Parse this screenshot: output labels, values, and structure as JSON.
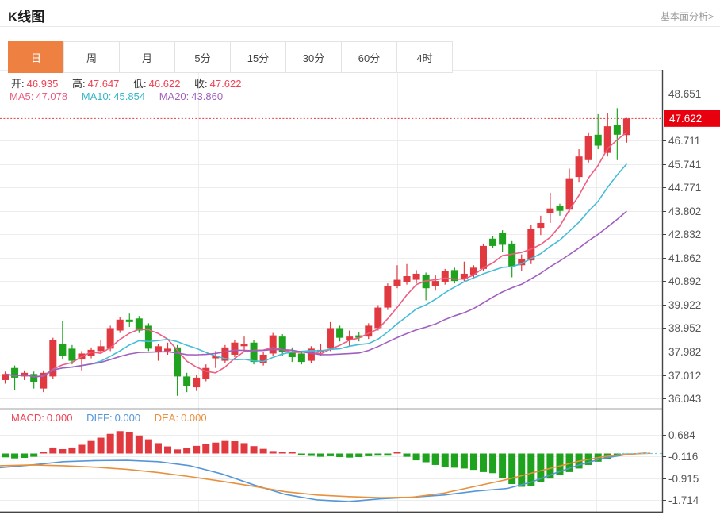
{
  "header": {
    "title": "K线图",
    "analysis_link": "基本面分析>"
  },
  "tabs": {
    "items": [
      "日",
      "周",
      "月",
      "5分",
      "15分",
      "30分",
      "60分",
      "4时"
    ],
    "active_index": 0
  },
  "legend": {
    "open_label": "开:",
    "open": "46.935",
    "high_label": "高:",
    "high": "47.647",
    "low_label": "低:",
    "low": "46.622",
    "close_label": "收:",
    "close": "47.622",
    "ma5_label": "MA5:",
    "ma5": "47.078",
    "ma10_label": "MA10:",
    "ma10": "45.854",
    "ma20_label": "MA20:",
    "ma20": "43.860"
  },
  "macd_legend": {
    "macd_label": "MACD:",
    "macd": "0.000",
    "diff_label": "DIFF:",
    "diff": "0.000",
    "dea_label": "DEA:",
    "dea": "0.000"
  },
  "price_marker": "47.622",
  "colors": {
    "up": "#e0393f",
    "down": "#1fa31f",
    "ma5": "#ee5d82",
    "ma10": "#45bcd8",
    "ma20": "#a05fc0",
    "diff": "#5596d8",
    "dea": "#e8903c",
    "tab_accent": "#ee8142",
    "price_box": "#e8000f",
    "price_line": "#e83b42",
    "grid": "#ededed",
    "axis": "#444444",
    "tick_text": "#555555",
    "zero_dash": "#7ecfdd"
  },
  "chart_data": {
    "type": "candlestick",
    "title": "K线图",
    "main": {
      "y_ticks": [
        "48.651",
        "47.622",
        "46.711",
        "45.741",
        "44.771",
        "43.802",
        "42.832",
        "41.862",
        "40.892",
        "39.922",
        "38.952",
        "37.982",
        "37.012",
        "36.043"
      ],
      "y_range": [
        36.043,
        48.651
      ],
      "current_price": 47.622,
      "ma_periods": [
        5,
        10,
        20
      ],
      "candles": [
        [
          36.8,
          37.05,
          37.15,
          36.65
        ],
        [
          37.3,
          36.9,
          37.4,
          36.4
        ],
        [
          36.95,
          37.1,
          37.2,
          36.8
        ],
        [
          37.05,
          36.7,
          37.15,
          36.45
        ],
        [
          36.45,
          37.1,
          37.2,
          36.3
        ],
        [
          36.95,
          38.45,
          38.55,
          36.85
        ],
        [
          38.3,
          37.8,
          39.25,
          37.65
        ],
        [
          38.1,
          37.6,
          38.25,
          37.45
        ],
        [
          37.65,
          37.9,
          38.0,
          37.2
        ],
        [
          37.8,
          38.05,
          38.15,
          37.7
        ],
        [
          38.0,
          38.2,
          38.45,
          37.9
        ],
        [
          38.1,
          38.95,
          39.05,
          38.0
        ],
        [
          38.85,
          39.3,
          39.4,
          38.75
        ],
        [
          39.3,
          39.2,
          39.55,
          39.0
        ],
        [
          39.35,
          38.85,
          39.45,
          38.75
        ],
        [
          39.05,
          38.1,
          39.15,
          38.0
        ],
        [
          37.95,
          38.2,
          38.3,
          37.6
        ],
        [
          38.0,
          38.1,
          38.35,
          37.85
        ],
        [
          38.15,
          36.95,
          38.25,
          36.15
        ],
        [
          36.95,
          36.55,
          37.1,
          36.3
        ],
        [
          36.5,
          36.9,
          37.0,
          36.35
        ],
        [
          36.85,
          37.3,
          37.45,
          36.75
        ],
        [
          37.7,
          37.8,
          38.0,
          37.3
        ],
        [
          37.6,
          38.15,
          38.25,
          37.5
        ],
        [
          37.85,
          38.35,
          38.45,
          37.75
        ],
        [
          38.2,
          38.3,
          38.6,
          37.95
        ],
        [
          38.35,
          37.55,
          38.45,
          37.45
        ],
        [
          37.5,
          37.85,
          37.95,
          37.4
        ],
        [
          37.9,
          38.65,
          38.75,
          37.8
        ],
        [
          38.6,
          37.95,
          38.7,
          37.8
        ],
        [
          37.95,
          37.75,
          38.15,
          37.55
        ],
        [
          37.9,
          37.55,
          38.0,
          37.45
        ],
        [
          37.6,
          38.1,
          38.2,
          37.5
        ],
        [
          37.95,
          38.05,
          38.3,
          37.8
        ],
        [
          38.1,
          38.95,
          39.2,
          38.0
        ],
        [
          38.95,
          38.55,
          39.05,
          38.4
        ],
        [
          38.45,
          38.6,
          38.85,
          38.2
        ],
        [
          38.65,
          38.55,
          38.8,
          38.4
        ],
        [
          38.6,
          39.05,
          39.15,
          38.5
        ],
        [
          38.95,
          39.8,
          39.9,
          38.85
        ],
        [
          39.8,
          40.7,
          40.8,
          39.7
        ],
        [
          40.7,
          40.95,
          41.55,
          40.6
        ],
        [
          40.85,
          41.1,
          41.6,
          40.75
        ],
        [
          40.95,
          41.2,
          41.35,
          40.8
        ],
        [
          41.15,
          40.6,
          41.25,
          40.1
        ],
        [
          40.7,
          40.9,
          41.15,
          40.5
        ],
        [
          40.85,
          41.3,
          41.4,
          40.75
        ],
        [
          41.35,
          40.9,
          41.45,
          40.8
        ],
        [
          41.0,
          41.2,
          41.7,
          40.9
        ],
        [
          41.15,
          41.45,
          41.55,
          41.05
        ],
        [
          41.4,
          42.35,
          42.45,
          41.3
        ],
        [
          42.65,
          42.35,
          42.75,
          42.25
        ],
        [
          42.9,
          42.4,
          43.0,
          42.1
        ],
        [
          42.45,
          41.5,
          42.55,
          41.05
        ],
        [
          41.55,
          41.8,
          42.0,
          41.3
        ],
        [
          41.75,
          43.05,
          43.2,
          41.6
        ],
        [
          43.1,
          43.3,
          43.6,
          42.8
        ],
        [
          43.7,
          43.9,
          44.55,
          43.3
        ],
        [
          44.0,
          43.8,
          44.1,
          43.6
        ],
        [
          43.85,
          45.15,
          45.55,
          43.75
        ],
        [
          45.2,
          46.05,
          46.35,
          45.0
        ],
        [
          45.9,
          46.9,
          47.05,
          45.8
        ],
        [
          46.95,
          46.5,
          47.8,
          46.35
        ],
        [
          46.2,
          47.3,
          47.85,
          46.05
        ],
        [
          47.35,
          46.95,
          48.05,
          45.9
        ],
        [
          46.935,
          47.622,
          47.647,
          46.622
        ]
      ]
    },
    "macd": {
      "y_ticks": [
        "0.684",
        "-0.116",
        "-0.915",
        "-1.714"
      ],
      "values": {
        "macd": 0.0,
        "diff": 0.0,
        "dea": 0.0
      },
      "histogram": [
        -0.14,
        -0.18,
        -0.16,
        -0.12,
        0.03,
        0.22,
        0.16,
        0.22,
        0.32,
        0.46,
        0.58,
        0.72,
        0.82,
        0.78,
        0.66,
        0.52,
        0.38,
        0.26,
        0.15,
        0.2,
        0.28,
        0.35,
        0.4,
        0.46,
        0.45,
        0.38,
        0.27,
        0.17,
        0.09,
        0.04,
        0.02,
        -0.05,
        -0.09,
        -0.12,
        -0.1,
        -0.13,
        -0.15,
        -0.13,
        -0.1,
        -0.08,
        -0.08,
        0.02,
        -0.12,
        -0.25,
        -0.32,
        -0.42,
        -0.48,
        -0.52,
        -0.55,
        -0.6,
        -0.68,
        -0.72,
        -0.9,
        -1.12,
        -1.22,
        -1.18,
        -1.05,
        -0.92,
        -0.8,
        -0.68,
        -0.55,
        -0.42,
        -0.3,
        -0.2,
        -0.1,
        -0.04
      ],
      "diff_line": [
        [
          0,
          -0.52
        ],
        [
          40,
          -0.42
        ],
        [
          80,
          -0.3
        ],
        [
          120,
          -0.26
        ],
        [
          160,
          -0.25
        ],
        [
          200,
          -0.3
        ],
        [
          240,
          -0.45
        ],
        [
          280,
          -0.75
        ],
        [
          320,
          -1.15
        ],
        [
          360,
          -1.5
        ],
        [
          400,
          -1.7
        ],
        [
          440,
          -1.76
        ],
        [
          480,
          -1.66
        ],
        [
          520,
          -1.6
        ],
        [
          560,
          -1.52
        ],
        [
          600,
          -1.38
        ],
        [
          640,
          -1.28
        ],
        [
          670,
          -1.05
        ],
        [
          700,
          -0.72
        ],
        [
          730,
          -0.42
        ],
        [
          760,
          -0.18
        ],
        [
          790,
          -0.04
        ],
        [
          815,
          0.02
        ]
      ],
      "dea_line": [
        [
          0,
          -0.45
        ],
        [
          40,
          -0.42
        ],
        [
          80,
          -0.45
        ],
        [
          120,
          -0.5
        ],
        [
          160,
          -0.58
        ],
        [
          200,
          -0.7
        ],
        [
          240,
          -0.85
        ],
        [
          280,
          -1.02
        ],
        [
          320,
          -1.2
        ],
        [
          360,
          -1.4
        ],
        [
          400,
          -1.52
        ],
        [
          440,
          -1.58
        ],
        [
          480,
          -1.62
        ],
        [
          520,
          -1.6
        ],
        [
          560,
          -1.45
        ],
        [
          600,
          -1.2
        ],
        [
          640,
          -0.95
        ],
        [
          670,
          -0.72
        ],
        [
          700,
          -0.5
        ],
        [
          730,
          -0.28
        ],
        [
          760,
          -0.12
        ],
        [
          790,
          -0.02
        ],
        [
          820,
          0.01
        ]
      ]
    }
  }
}
